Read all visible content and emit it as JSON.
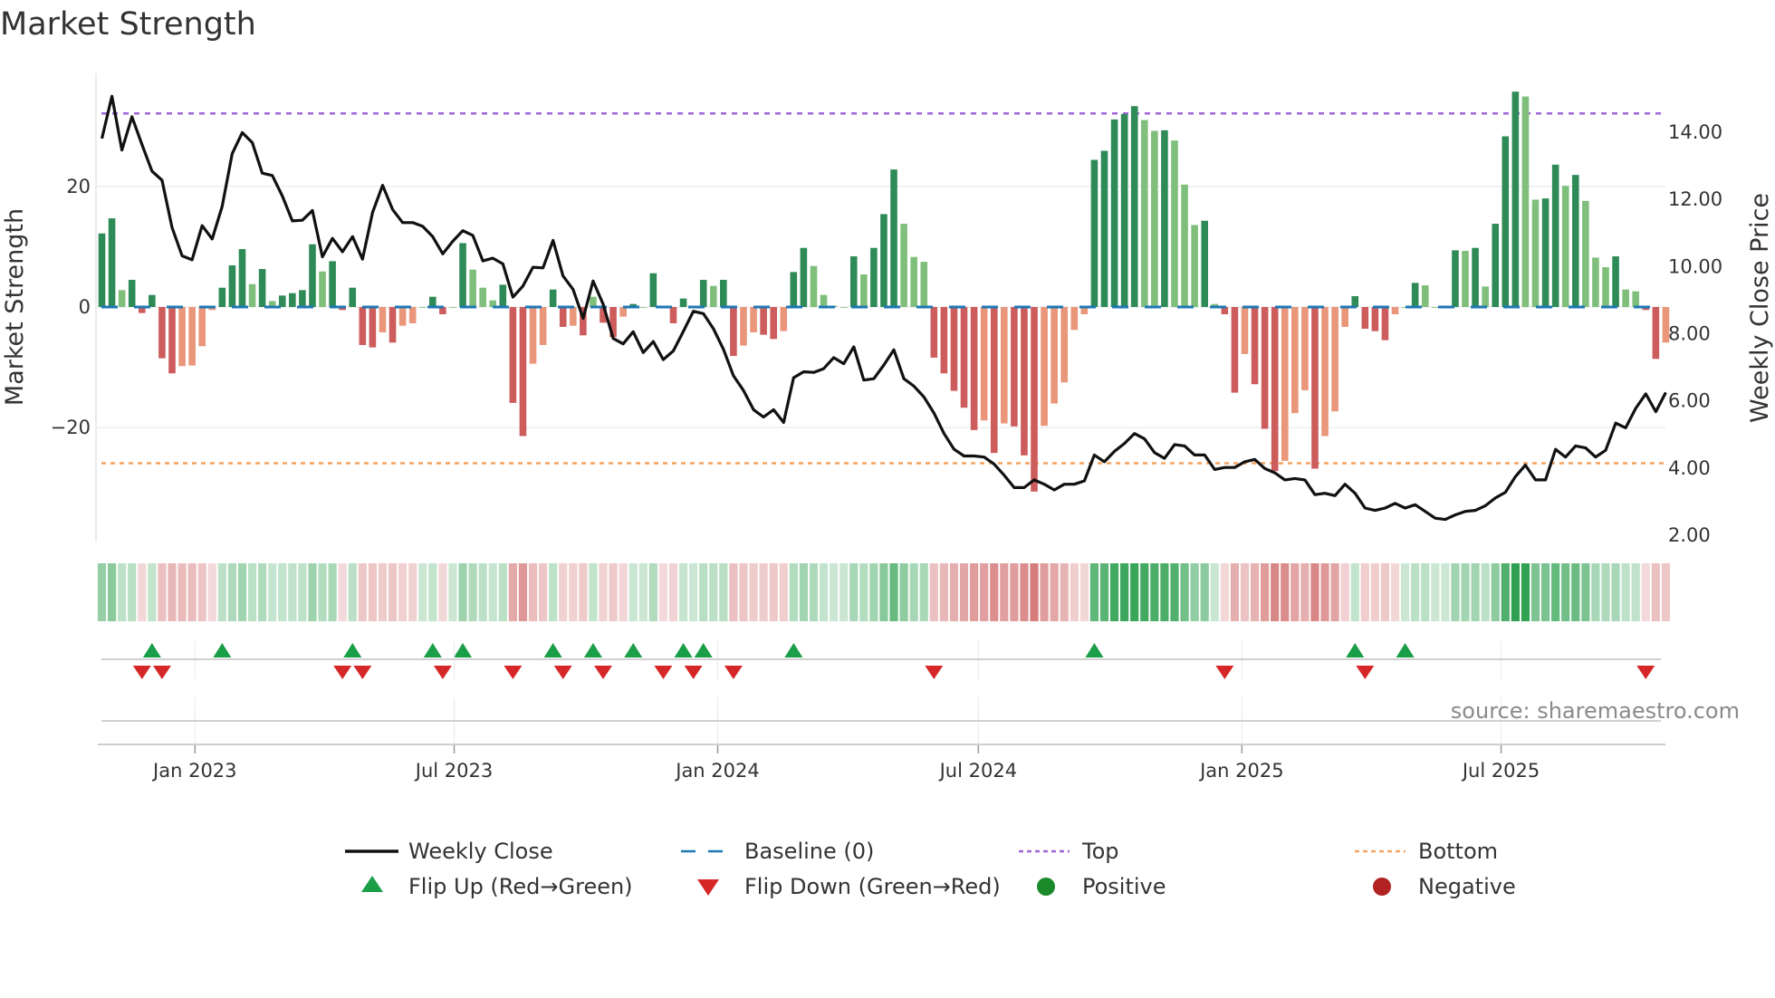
{
  "title": "Market Strength",
  "source": "source: sharemaestro.com",
  "colors": {
    "pos_strong": "#2e8b57",
    "pos_weak": "#7fbf7b",
    "neg_strong": "#cd5c5c",
    "neg_weak": "#e9967a",
    "close": "#111111",
    "baseline": "#1f77b4",
    "top": "#a066d8",
    "bottom": "#f4a460",
    "flip_up": "#1a9e47",
    "flip_down": "#d62728",
    "positive": "#1a8a2a",
    "negative": "#b22222"
  },
  "chart_data": {
    "type": "bar+line",
    "title": "Market Strength",
    "ylabel": "Market Strength",
    "y2label": "Weekly Close Price",
    "start_date": "2022-10-28",
    "interval": "weekly",
    "ylim": [
      -39,
      42.5
    ],
    "y2lim": [
      1.2,
      15.9
    ],
    "left_ticks": [
      {
        "v": 20,
        "label": "20"
      },
      {
        "v": 0,
        "label": "0"
      },
      {
        "v": -20,
        "label": "−20"
      }
    ],
    "right_ticks": [
      {
        "v": 14,
        "label": "14.00"
      },
      {
        "v": 12,
        "label": "12.00"
      },
      {
        "v": 10,
        "label": "10.00"
      },
      {
        "v": 8,
        "label": "8.00"
      },
      {
        "v": 6,
        "label": "6.00"
      },
      {
        "v": 4,
        "label": "4.00"
      },
      {
        "v": 2,
        "label": "2.00"
      }
    ],
    "x_ticks": [
      {
        "date": "2023-01-01",
        "label": "Jan 2023"
      },
      {
        "date": "2023-07-01",
        "label": "Jul 2023"
      },
      {
        "date": "2024-01-01",
        "label": "Jan 2024"
      },
      {
        "date": "2024-07-01",
        "label": "Jul 2024"
      },
      {
        "date": "2025-01-01",
        "label": "Jan 2025"
      },
      {
        "date": "2025-07-01",
        "label": "Jul 2025"
      }
    ],
    "top_level": 32.1,
    "bottom_level": -25.9,
    "baseline": 0,
    "strength": [
      12.2,
      14.7,
      2.8,
      4.5,
      -1,
      2,
      -8.5,
      -11,
      -9.8,
      -9.7,
      -6.5,
      -0.5,
      3.2,
      6.9,
      9.6,
      3.8,
      6.3,
      1,
      1.9,
      2.3,
      2.8,
      10.4,
      5.9,
      7.6,
      -0.5,
      3.2,
      -6.3,
      -6.7,
      -4.2,
      -5.9,
      -3.1,
      -2.7,
      0,
      1.7,
      -1.2,
      0,
      10.6,
      6.2,
      3.2,
      1.1,
      3.7,
      -15.9,
      -21.4,
      -9.4,
      -6.3,
      2.9,
      -3.3,
      -3.1,
      -4.7,
      1.7,
      -2.6,
      -5,
      -1.6,
      0.5,
      0,
      5.6,
      -0.2,
      -2.7,
      1.4,
      0,
      4.5,
      3.5,
      4.5,
      -8.1,
      -6.4,
      -4.2,
      -4.6,
      -5.3,
      -4,
      5.8,
      9.8,
      6.8,
      2,
      0.2,
      0,
      8.4,
      5.4,
      9.8,
      15.4,
      22.8,
      13.8,
      8.3,
      7.5,
      -8.4,
      -11,
      -13.9,
      -16.7,
      -20.4,
      -18.8,
      -24.2,
      -19.3,
      -19.8,
      -24.6,
      -30.6,
      -19.7,
      -16,
      -12.5,
      -3.8,
      -1.2,
      24.4,
      25.9,
      31.1,
      32,
      33.3,
      31,
      29.2,
      29.3,
      27.6,
      20.3,
      13.6,
      14.3,
      0.5,
      -1.2,
      -14.2,
      -7.8,
      -12.8,
      -20.2,
      -27.2,
      -25.5,
      -17.6,
      -13.8,
      -26.8,
      -21.4,
      -17.3,
      -3.3,
      1.8,
      -3.6,
      -4,
      -5.5,
      -1.2,
      0,
      4,
      3.6,
      0,
      0,
      9.4,
      9.3,
      9.8,
      3.4,
      13.8,
      28.3,
      35.7,
      34.9,
      17.8,
      18,
      23.6,
      20.1,
      21.9,
      17.6,
      8.2,
      6.6,
      8.4,
      2.9,
      2.6,
      -0.5,
      -8.6,
      -5.9
    ],
    "strength_shade": "DDLDDDDDLLLLDDDLDLDDDDLDDDDDLDLLLDDLDLLLDDDLLDDLDLDDLDLDLDDLDLDDLLDDLDDLLLLDLDDDLLLDDDDDLDLDDDLLLLLDDDDDLLDLLLDLDDLDDDLLLDLLLDDDDLLDLLLDLDLDDDLLDDLDLLLDLLDDL",
    "weekly_close": [
      13.81,
      15.07,
      13.47,
      14.46,
      13.63,
      12.84,
      12.57,
      11.16,
      10.32,
      10.2,
      11.22,
      10.82,
      11.79,
      13.36,
      13.99,
      13.69,
      12.78,
      12.71,
      12.1,
      11.36,
      11.38,
      11.67,
      10.29,
      10.84,
      10.44,
      10.89,
      10.22,
      11.61,
      12.42,
      11.7,
      11.31,
      11.31,
      11.2,
      10.89,
      10.38,
      10.75,
      11.07,
      10.93,
      10.17,
      10.25,
      10.08,
      9.09,
      9.42,
      9.98,
      9.96,
      10.78,
      9.72,
      9.32,
      8.46,
      9.57,
      8.88,
      7.86,
      7.7,
      8.06,
      7.44,
      7.77,
      7.23,
      7.49,
      8.07,
      8.67,
      8.6,
      8.15,
      7.54,
      6.75,
      6.31,
      5.74,
      5.52,
      5.74,
      5.36,
      6.69,
      6.87,
      6.85,
      6.96,
      7.29,
      7.11,
      7.61,
      6.62,
      6.66,
      7.07,
      7.52,
      6.66,
      6.44,
      6.12,
      5.64,
      5.03,
      4.56,
      4.36,
      4.36,
      4.33,
      4.12,
      3.79,
      3.42,
      3.42,
      3.65,
      3.52,
      3.35,
      3.52,
      3.52,
      3.62,
      4.39,
      4.19,
      4.5,
      4.73,
      5.03,
      4.87,
      4.46,
      4.29,
      4.7,
      4.66,
      4.39,
      4.39,
      3.96,
      4.02,
      4.02,
      4.19,
      4.26,
      3.99,
      3.86,
      3.65,
      3.69,
      3.65,
      3.21,
      3.25,
      3.18,
      3.52,
      3.25,
      2.81,
      2.74,
      2.81,
      2.95,
      2.81,
      2.91,
      2.71,
      2.51,
      2.47,
      2.61,
      2.71,
      2.74,
      2.88,
      3.11,
      3.28,
      3.75,
      4.09,
      3.65,
      3.65,
      4.56,
      4.33,
      4.66,
      4.6,
      4.33,
      4.53,
      5.34,
      5.2,
      5.78,
      6.21,
      5.68,
      6.25
    ],
    "flip_up_weeks": [
      5,
      12,
      25,
      33,
      36,
      45,
      49,
      53,
      58,
      60,
      69,
      99,
      125,
      130
    ],
    "flip_down_weeks": [
      4,
      6,
      24,
      26,
      34,
      41,
      46,
      50,
      56,
      59,
      63,
      83,
      112,
      126,
      154
    ]
  },
  "legend": [
    {
      "key": "weekly-close",
      "label": "Weekly Close"
    },
    {
      "key": "baseline",
      "label": "Baseline (0)"
    },
    {
      "key": "top",
      "label": "Top"
    },
    {
      "key": "bottom",
      "label": "Bottom"
    },
    {
      "key": "flip-up",
      "label": "Flip Up (Red→Green)"
    },
    {
      "key": "flip-down",
      "label": "Flip Down (Green→Red)"
    },
    {
      "key": "positive",
      "label": "Positive"
    },
    {
      "key": "negative",
      "label": "Negative"
    }
  ]
}
